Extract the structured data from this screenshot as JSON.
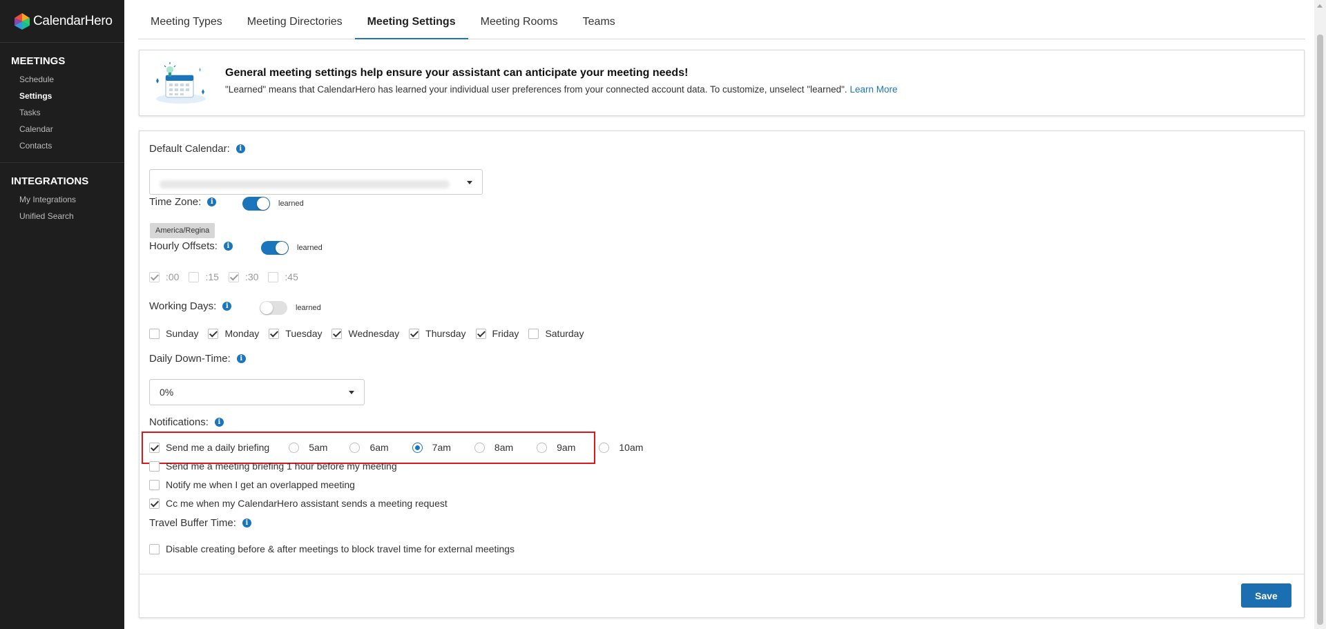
{
  "brand": {
    "name": "CalendarHero"
  },
  "sidebar": {
    "sections": [
      {
        "heading": "MEETINGS",
        "items": [
          {
            "label": "Schedule",
            "active": false
          },
          {
            "label": "Settings",
            "active": true
          },
          {
            "label": "Tasks",
            "active": false
          },
          {
            "label": "Calendar",
            "active": false
          },
          {
            "label": "Contacts",
            "active": false
          }
        ]
      },
      {
        "heading": "INTEGRATIONS",
        "items": [
          {
            "label": "My Integrations",
            "active": false
          },
          {
            "label": "Unified Search",
            "active": false
          }
        ]
      }
    ]
  },
  "tabs": [
    {
      "label": "Meeting Types",
      "active": false
    },
    {
      "label": "Meeting Directories",
      "active": false
    },
    {
      "label": "Meeting Settings",
      "active": true
    },
    {
      "label": "Meeting Rooms",
      "active": false
    },
    {
      "label": "Teams",
      "active": false
    }
  ],
  "banner": {
    "title": "General meeting settings help ensure your assistant can anticipate your meeting needs!",
    "text": "\"Learned\" means that CalendarHero has learned your individual user preferences from your connected account data. To customize, unselect \"learned\".",
    "link": "Learn More"
  },
  "settings": {
    "default_calendar": {
      "label": "Default Calendar:",
      "value": ""
    },
    "time_zone": {
      "label": "Time Zone:",
      "toggle_on": true,
      "toggle_label": "learned",
      "value": "America/Regina"
    },
    "hourly_offsets": {
      "label": "Hourly Offsets:",
      "toggle_on": true,
      "toggle_label": "learned",
      "options": [
        {
          "label": ":00",
          "checked": true
        },
        {
          "label": ":15",
          "checked": false
        },
        {
          "label": ":30",
          "checked": true
        },
        {
          "label": ":45",
          "checked": false
        }
      ]
    },
    "working_days": {
      "label": "Working Days:",
      "toggle_on": false,
      "toggle_label": "learned",
      "days": [
        {
          "label": "Sunday",
          "checked": false
        },
        {
          "label": "Monday",
          "checked": true
        },
        {
          "label": "Tuesday",
          "checked": true
        },
        {
          "label": "Wednesday",
          "checked": true
        },
        {
          "label": "Thursday",
          "checked": true
        },
        {
          "label": "Friday",
          "checked": true
        },
        {
          "label": "Saturday",
          "checked": false
        }
      ]
    },
    "daily_downtime": {
      "label": "Daily Down-Time:",
      "value": "0%"
    },
    "notifications": {
      "label": "Notifications:",
      "daily_briefing": {
        "label": "Send me a daily briefing",
        "checked": true,
        "times": [
          {
            "label": "5am",
            "selected": false
          },
          {
            "label": "6am",
            "selected": false
          },
          {
            "label": "7am",
            "selected": true
          },
          {
            "label": "8am",
            "selected": false
          },
          {
            "label": "9am",
            "selected": false
          },
          {
            "label": "10am",
            "selected": false
          }
        ]
      },
      "meeting_briefing": {
        "label": "Send me a meeting briefing 1 hour before my meeting",
        "checked": false
      },
      "overlapped": {
        "label": "Notify me when I get an overlapped meeting",
        "checked": false
      },
      "cc_me": {
        "label": "Cc me when my CalendarHero assistant sends a meeting request",
        "checked": true
      }
    },
    "travel_buffer": {
      "label": "Travel Buffer Time:",
      "disable": {
        "label": "Disable creating before & after meetings to block travel time for external meetings",
        "checked": false
      }
    }
  },
  "actions": {
    "save_label": "Save"
  },
  "colors": {
    "accent": "#1b75bc",
    "sidebar_bg": "#1e1e1e",
    "highlight": "#e0151c"
  }
}
